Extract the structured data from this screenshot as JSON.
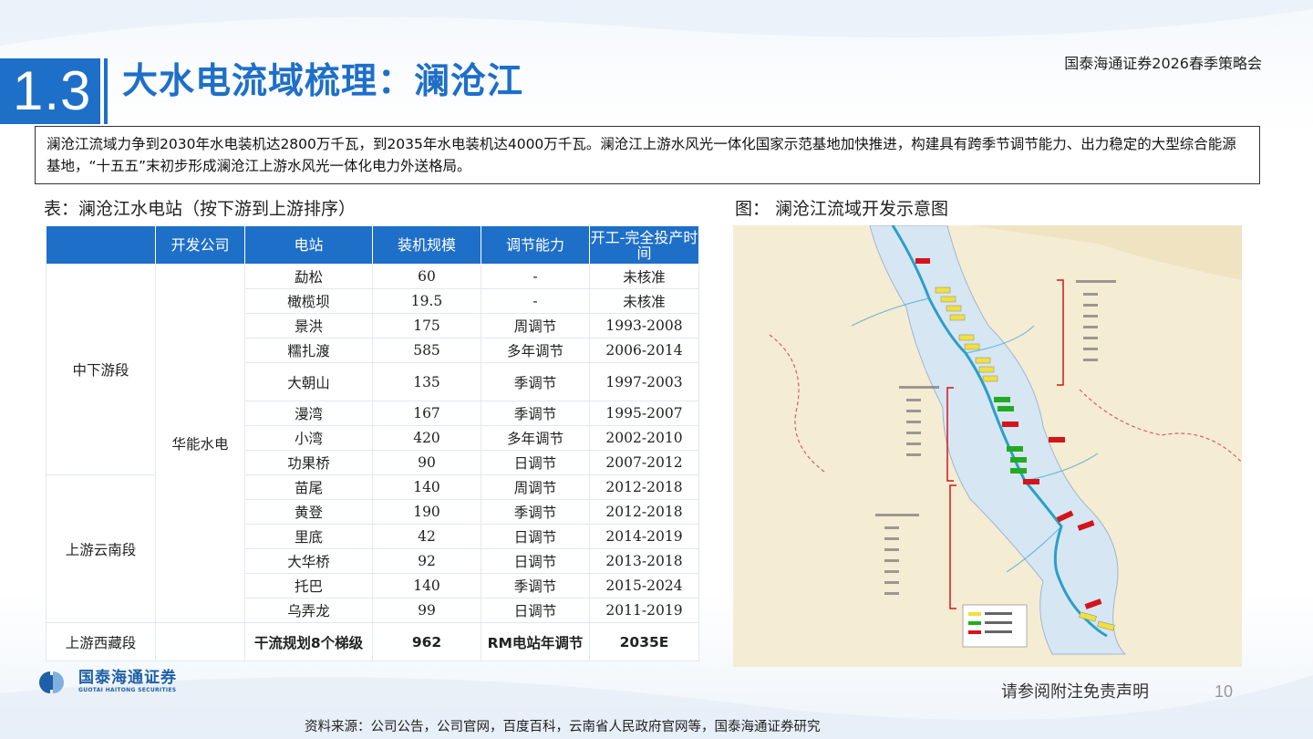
{
  "header": {
    "section_number": "1.3",
    "title": "大水电流域梳理：澜沧江",
    "brand_strategy": "国泰海通证券2026春季策略会"
  },
  "summary": "澜沧江流域力争到2030年水电装机达2800万千瓦，到2035年水电装机达4000万千瓦。澜沧江上游水风光一体化国家示范基地加快推进，构建具有跨季节调节能力、出力稳定的大型综合能源基地，“十五五”末初步形成澜沧江上游水风光一体化电力外送格局。",
  "table_caption": "表：澜沧江水电站（按下游到上游排序）",
  "figure_caption": "图： 澜沧江流域开发示意图",
  "table": {
    "headers": [
      "",
      "开发公司",
      "电站",
      "装机规模",
      "调节能力",
      "开工-完全投产时间"
    ],
    "segments": [
      {
        "name": "中下游段",
        "rowspan": 8
      },
      {
        "name": "上游云南段",
        "rowspan": 6
      },
      {
        "name": "上游西藏段",
        "rowspan": 1
      }
    ],
    "company": "华能水电",
    "rows": [
      {
        "station": "勐松",
        "capacity": "60",
        "regulation": "-",
        "period": "未核准"
      },
      {
        "station": "橄榄坝",
        "capacity": "19.5",
        "regulation": "-",
        "period": "未核准"
      },
      {
        "station": "景洪",
        "capacity": "175",
        "regulation": "周调节",
        "period": "1993-2008"
      },
      {
        "station": "糯扎渡",
        "capacity": "585",
        "regulation": "多年调节",
        "period": "2006-2014"
      },
      {
        "station": "大朝山",
        "capacity": "135",
        "regulation": "季调节",
        "period": "1997-2003"
      },
      {
        "station": "漫湾",
        "capacity": "167",
        "regulation": "季调节",
        "period": "1995-2007"
      },
      {
        "station": "小湾",
        "capacity": "420",
        "regulation": "多年调节",
        "period": "2002-2010"
      },
      {
        "station": "功果桥",
        "capacity": "90",
        "regulation": "日调节",
        "period": "2007-2012"
      },
      {
        "station": "苗尾",
        "capacity": "140",
        "regulation": "周调节",
        "period": "2012-2018"
      },
      {
        "station": "黄登",
        "capacity": "190",
        "regulation": "季调节",
        "period": "2012-2018"
      },
      {
        "station": "里底",
        "capacity": "42",
        "regulation": "日调节",
        "period": "2014-2019"
      },
      {
        "station": "大华桥",
        "capacity": "92",
        "regulation": "日调节",
        "period": "2013-2018"
      },
      {
        "station": "托巴",
        "capacity": "140",
        "regulation": "季调节",
        "period": "2015-2024"
      },
      {
        "station": "乌弄龙",
        "capacity": "99",
        "regulation": "日调节",
        "period": "2011-2019"
      }
    ],
    "tibet_row": {
      "station": "干流规划8个梯级",
      "capacity": "962",
      "regulation": "RM电站年调节",
      "period": "2035E"
    }
  },
  "footer": {
    "logo_cn": "国泰海通证券",
    "logo_en": "GUOTAI HAITONG SECURITIES",
    "disclaimer": "请参阅附注免责声明",
    "page_number": "10",
    "source": "资料来源：公司公告，公司官网，百度百科，云南省人民政府官网等，国泰海通证券研究"
  },
  "colors": {
    "brand_blue": "#1e6fc8",
    "map_red": "#d4141c",
    "map_green": "#22aa22",
    "map_yellow": "#f0e040"
  }
}
